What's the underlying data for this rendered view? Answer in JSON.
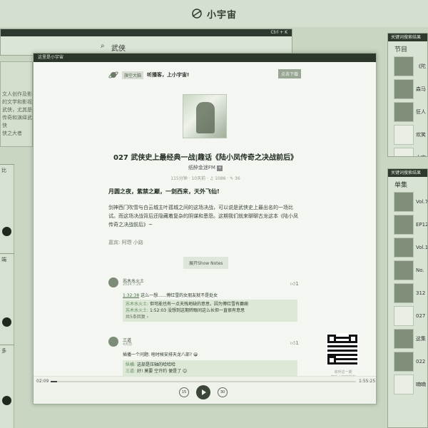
{
  "app": {
    "title": "小宇宙"
  },
  "background": {
    "search_shortcut": "Ctrl + K",
    "search_query": "武侠",
    "left_text": "文人创作及影\n的文学和影视\n武侠，尤其是\n传奇和演绎武侠\n侠之大者",
    "left_blocks": [
      "比",
      "端",
      "多"
    ]
  },
  "right_panel_top": {
    "header": "关键词搜索结果",
    "section": "节目",
    "items": [
      {
        "text": "《陀"
      },
      {
        "text": "森马"
      },
      {
        "text": "狂人"
      },
      {
        "text": "欢笑"
      },
      {
        "text": "大宋"
      }
    ]
  },
  "right_panel_bottom": {
    "header": "关键词搜索结果",
    "section": "单集",
    "items": [
      {
        "text": "Vol.7"
      },
      {
        "text": "EP12"
      },
      {
        "text": "Vol.1"
      },
      {
        "text": "No."
      },
      {
        "text": "312"
      },
      {
        "text": "027"
      },
      {
        "text": "这集"
      },
      {
        "text": "022"
      },
      {
        "text": "喃喃"
      }
    ]
  },
  "modal": {
    "window_title": "这里是小宇宙",
    "tag": "旗空大脑",
    "slogan": "听播客，上小宇宙!",
    "download_button": "点击下载",
    "episode_title": "027 武侠史上最经典一战|趣话《陆小凤传奇之决战前后》",
    "podcast_name": "纸醉金迷FM",
    "meta": "115分钟 · 10天前 · ♫ 1086 · ✎ 36",
    "lead": "月圆之夜，紫禁之巅，一剑西来，天外飞仙!",
    "description": "剑神西门吹雪与白云城主叶孤城之间的这场决战，可以说是武侠史上最出名的一场比试。而这场决战背后还隐藏着复杂的阴谋和恩怨。这期我们就来聊聊古龙这本《陆小凤传奇之决战前后》~",
    "guests": "嘉宾: 阿瓒 小路",
    "show_notes_button": "展开Show Notes",
    "comments": [
      {
        "name": "苏木水火土",
        "date": "2024.7.29",
        "likes": "1",
        "timestamp": "1:32:38",
        "text": "这么一想……傅红雪的女朋友就不是处女",
        "replies": [
          {
            "name": "苏木水火土:",
            "text": "但可能也有一点天残地缺的意思，因为傅红雪有癫痫"
          },
          {
            "name": "苏木水火土:",
            "text": "1:52:03 没想到这期转眼间这么长但一直很有意思"
          }
        ],
        "more_replies": "共5条回复 ›"
      },
      {
        "name": "三道",
        "date": "4天前",
        "likes": "1",
        "text": "插播一个问题: 啥时候安排天龙八部? 😁",
        "replies": [
          {
            "name": "纵横:",
            "text": "这部是压轴的哈哈哈"
          },
          {
            "name": "三道:",
            "text": "好! 莫要 空许约 便是了 😊"
          }
        ]
      }
    ],
    "qr_caption": "收听这一期\n来听小宇宙播客",
    "player": {
      "current": "02:09",
      "total": "1:55:25",
      "progress": 0.02,
      "rewind": "15",
      "forward": "30"
    }
  }
}
